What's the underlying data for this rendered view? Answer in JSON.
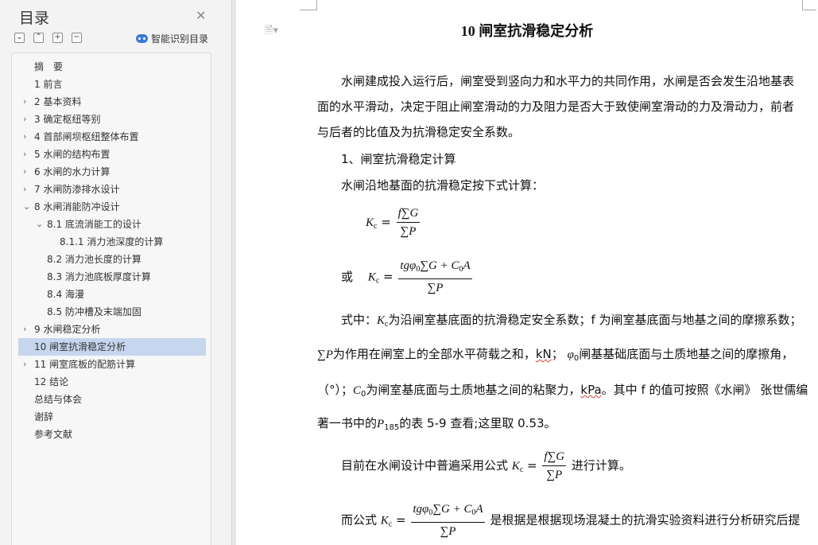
{
  "sidebar": {
    "title": "目录",
    "close_glyph": "✕",
    "toolbar": {
      "collapse_glyph": "⌄",
      "expand_glyph": "⌃",
      "add_glyph": "+",
      "remove_glyph": "−",
      "smart_label": "智能识别目录"
    },
    "items": [
      {
        "label": "摘　要",
        "arrow": ""
      },
      {
        "label": "1 前言",
        "arrow": ""
      },
      {
        "label": "2 基本资料",
        "arrow": "›"
      },
      {
        "label": "3  确定枢纽等别",
        "arrow": "›"
      },
      {
        "label": "4 首部闸坝枢纽整体布置",
        "arrow": "›"
      },
      {
        "label": "5 水闸的结构布置",
        "arrow": "›"
      },
      {
        "label": "6 水闸的水力计算",
        "arrow": "›"
      },
      {
        "label": "7 水闸防渗排水设计",
        "arrow": "›"
      },
      {
        "label": "8 水闸消能防冲设计",
        "arrow": "⌄"
      },
      {
        "label": "8.1 底流消能工的设计",
        "arrow": "⌄"
      },
      {
        "label": "8.1.1 消力池深度的计算",
        "arrow": ""
      },
      {
        "label": "8.2 消力池长度的计算",
        "arrow": ""
      },
      {
        "label": "8.3 消力池底板厚度计算",
        "arrow": ""
      },
      {
        "label": "8.4  海漫",
        "arrow": ""
      },
      {
        "label": "8.5  防冲槽及末端加固",
        "arrow": ""
      },
      {
        "label": "9 水闸稳定分析",
        "arrow": "›"
      },
      {
        "label": "10 闸室抗滑稳定分析",
        "arrow": "",
        "active": true
      },
      {
        "label": "11 闸室底板的配筋计算",
        "arrow": "›"
      },
      {
        "label": "12 结论",
        "arrow": ""
      },
      {
        "label": "总结与体会",
        "arrow": ""
      },
      {
        "label": "谢辞",
        "arrow": ""
      },
      {
        "label": "参考文献",
        "arrow": ""
      }
    ]
  },
  "document": {
    "icon_glyph": "🗎▾",
    "title": "10 闸室抗滑稳定分析",
    "intro": "水闸建成投入运行后，闸室受到竖向力和水平力的共同作用，水闸是否会发生沿地基表面的水平滑动，决定于阻止闸室滑动的力及阻力是否大于致使闸室滑动的力及滑动力，前者与后者的比值及为抗滑稳定安全系数。",
    "heading1": "1、闸室抗滑稳定计算",
    "formula_intro": "水闸沿地基面的抗滑稳定按下式计算：",
    "or_word": "或",
    "f1_lhs": "K",
    "f1_lhs_sub": "c",
    "f1_num": "f∑G",
    "f1_den": "∑P",
    "f2_num_a": "tgφ",
    "f2_num_b": "∑G + C",
    "f2_num_c": "A",
    "sub_zero": "0",
    "where_a": "式中：",
    "where_b": "为沿闸室基底面的抗滑稳定安全系数；f 为闸室基底面与地基之间的摩擦系数；",
    "line2_a": "为作用在闸室上的全部水平荷载之和，",
    "kN": "kN",
    "line2_b": "；",
    "line2_c": "闸基基础底面与土质地基之间的摩擦角，",
    "line3_a": "（°）；",
    "line3_b": "为闸室基底面与土质地基之间的粘聚力，",
    "kPa": "kPa",
    "line3_c": "。其中 f 的值可按照《水闸》 张世儒编",
    "line4_a": "著一书中的",
    "line4_p": "P",
    "line4_sub": "185",
    "line4_b": "的表 5-9 查看;这里取 0.53。",
    "line5_a": "目前在水闸设计中普遍采用公式",
    "line5_b": "进行计算。",
    "line6_a": "而公式",
    "line6_b": "是根据是根据现场混凝土的抗滑实验资料进行分析研究后提"
  }
}
